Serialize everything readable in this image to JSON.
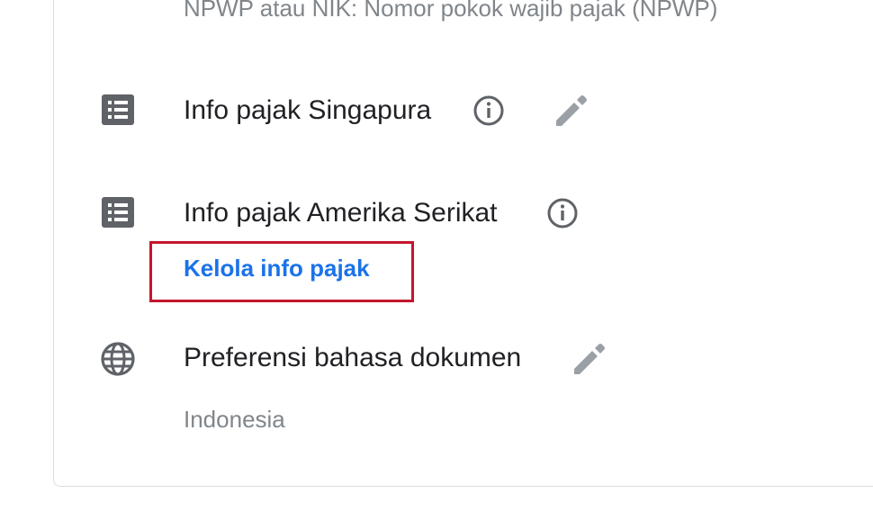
{
  "tax_section": {
    "npwp_description": "NPWP atau NIK: Nomor pokok wajib pajak (NPWP)",
    "rows": [
      {
        "label": "Info pajak Singapura",
        "icon": "list-icon",
        "has_info": true,
        "has_edit": true
      },
      {
        "label": "Info pajak Amerika Serikat",
        "icon": "list-icon",
        "has_info": true,
        "has_edit": false,
        "link": "Kelola info pajak"
      },
      {
        "label": "Preferensi bahasa dokumen",
        "icon": "globe-icon",
        "has_info": false,
        "has_edit": true,
        "value": "Indonesia"
      }
    ]
  },
  "colors": {
    "link": "#1a73e8",
    "highlight_border": "#c5162e",
    "icon_gray": "#5f6368",
    "edit_gray": "#9aa0a6",
    "secondary_text": "#80868b"
  }
}
